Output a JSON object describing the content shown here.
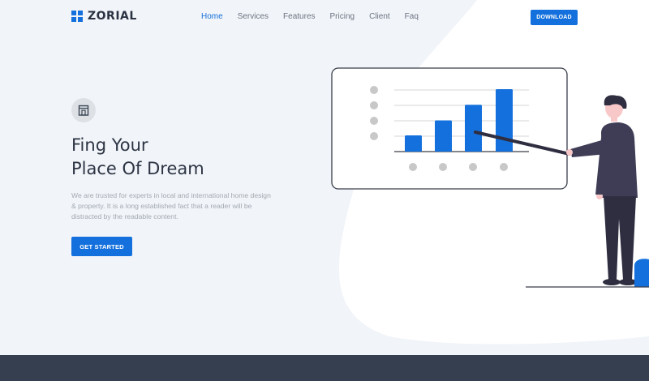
{
  "brand": {
    "name": "ZORIAL"
  },
  "nav": {
    "items": [
      {
        "label": "Home",
        "active": true
      },
      {
        "label": "Services",
        "active": false
      },
      {
        "label": "Features",
        "active": false
      },
      {
        "label": "Pricing",
        "active": false
      },
      {
        "label": "Client",
        "active": false
      },
      {
        "label": "Faq",
        "active": false
      }
    ],
    "download_label": "DOWNLOAD"
  },
  "hero": {
    "title_line1": "Fing Your",
    "title_line2": "Place Of Dream",
    "description": "We are trusted for experts in local and international home design & property. It is a long established fact that a reader will be distracted by the readable content.",
    "cta_label": "GET STARTED",
    "icon": "building-icon"
  },
  "illustration": {
    "board_bars": [
      0.26,
      0.5,
      0.75,
      1.0
    ],
    "icons": [
      "presentation-board",
      "presenter-person"
    ]
  },
  "colors": {
    "accent": "#1470dc",
    "text_dark": "#2c3444",
    "footer": "#353f4f",
    "background": "#f1f4f8"
  }
}
